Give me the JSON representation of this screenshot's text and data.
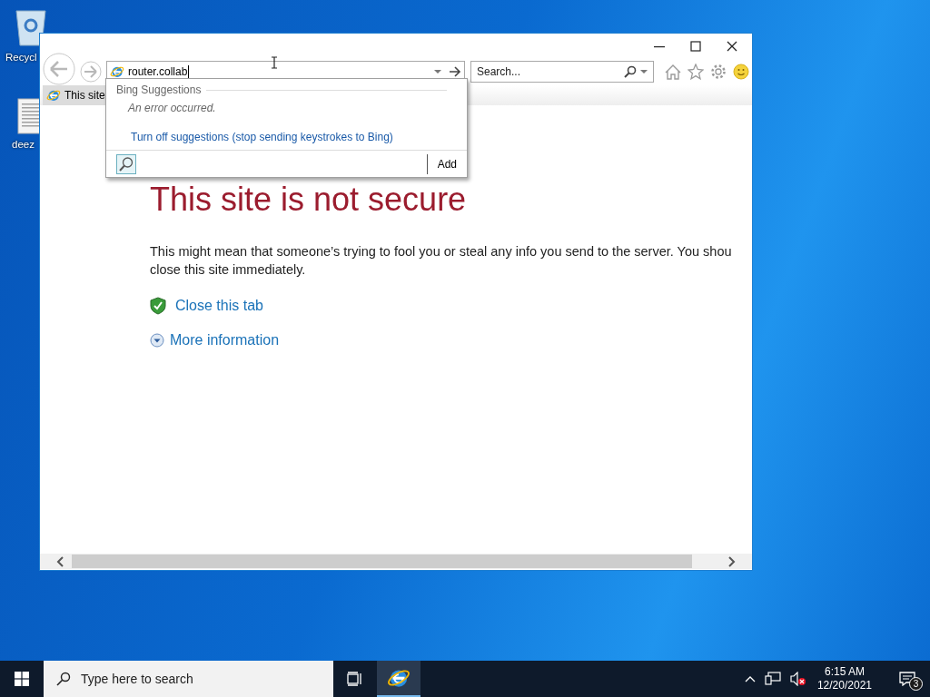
{
  "desktop": {
    "icons": [
      {
        "kind": "bin",
        "label": "Recycl"
      },
      {
        "kind": "file",
        "label": "deez"
      }
    ]
  },
  "window": {
    "address": "router.collab",
    "search_placeholder": "Search...",
    "tab": {
      "title": "This site"
    },
    "suggestions": {
      "heading": "Bing Suggestions",
      "error": "An error occurred.",
      "link": "Turn off suggestions (stop sending keystrokes to Bing)",
      "add": "Add"
    },
    "page": {
      "heading": "This site is not secure",
      "lines": [
        "This might mean that someone’s trying to fool you or steal any info you send to the server. You shou",
        "close this site immediately."
      ],
      "links": [
        {
          "kind": "shield",
          "label": "Close this tab"
        },
        {
          "kind": "expand",
          "label": "More information"
        }
      ]
    }
  },
  "taskbar": {
    "search_placeholder": "Type here to search",
    "apps": [
      {
        "kind": "browser",
        "selected": true
      }
    ],
    "time": "6:15 AM",
    "date": "12/20/2021",
    "notifications": "3"
  }
}
